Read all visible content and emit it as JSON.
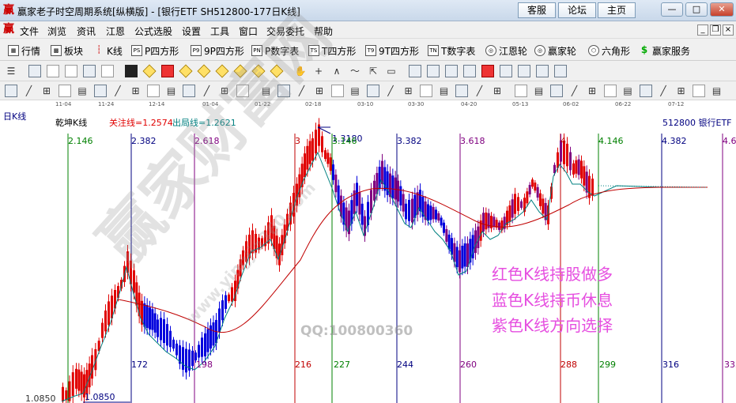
{
  "window": {
    "title": "赢家老子时空周期系统[纵横版] - [银行ETF  SH512800-177日K线]",
    "buttons": [
      "客服",
      "论坛",
      "主页"
    ],
    "controls": [
      "—",
      "□",
      "✕"
    ]
  },
  "menu": {
    "items": [
      "文件",
      "浏览",
      "资讯",
      "江恩",
      "公式选股",
      "设置",
      "工具",
      "窗口",
      "交易委托",
      "帮助"
    ],
    "mdi_controls": [
      "_",
      "❐",
      "×"
    ]
  },
  "function_bar": [
    {
      "label": "行情",
      "icon": "quote-grid-icon"
    },
    {
      "label": "板块",
      "icon": "sector-blocks-icon"
    },
    {
      "label": "K线",
      "icon": "kline-icon"
    },
    {
      "label": "P四方形",
      "icon": "PS"
    },
    {
      "label": "9P四方形",
      "icon": "P9"
    },
    {
      "label": "P数字表",
      "icon": "PN"
    },
    {
      "label": "T四方形",
      "icon": "TS"
    },
    {
      "label": "9T四方形",
      "icon": "T9"
    },
    {
      "label": "T数字表",
      "icon": "TN"
    },
    {
      "label": "江恩轮",
      "icon": "wheel-icon"
    },
    {
      "label": "赢家轮",
      "icon": "wheel-icon"
    },
    {
      "label": "六角形",
      "icon": "hexagon-icon"
    },
    {
      "label": "赢家服务",
      "icon": "dollar-icon"
    }
  ],
  "date_axis": [
    "11-04",
    "11-24",
    "12-14",
    "01-04",
    "01-22",
    "02-18",
    "03-10",
    "03-30",
    "04-20",
    "05-13",
    "06-02",
    "06-22",
    "07-12"
  ],
  "chart": {
    "left_title": "日K线",
    "subtitle": "乾坤K线",
    "indicator_focus": "关注线=1.2574",
    "indicator_exit": "出局线=1.2621",
    "symbol": "512800  银行ETF",
    "high_label": "1.3180",
    "low_label": "1.0850",
    "y_axis_low": "1.0850",
    "cycle_labels_top": [
      {
        "text": "2.146",
        "color": "#008000"
      },
      {
        "text": "2.382",
        "color": "#000080"
      },
      {
        "text": "2.618",
        "color": "#800080"
      },
      {
        "text": "3",
        "color": "#c00000"
      },
      {
        "text": "3.146",
        "color": "#008000"
      },
      {
        "text": "3.382",
        "color": "#000080"
      },
      {
        "text": "3.618",
        "color": "#800080"
      },
      {
        "text": "4",
        "color": "#c00000"
      },
      {
        "text": "4.146",
        "color": "#008000"
      },
      {
        "text": "4.382",
        "color": "#000080"
      },
      {
        "text": "4.6",
        "color": "#800080"
      }
    ],
    "cycle_labels_bottom": [
      {
        "text": "172",
        "color": "#000080"
      },
      {
        "text": "198",
        "color": "#800080"
      },
      {
        "text": "216",
        "color": "#c00000"
      },
      {
        "text": "227",
        "color": "#008000"
      },
      {
        "text": "244",
        "color": "#000080"
      },
      {
        "text": "260",
        "color": "#800080"
      },
      {
        "text": "288",
        "color": "#c00000"
      },
      {
        "text": "299",
        "color": "#008000"
      },
      {
        "text": "316",
        "color": "#000080"
      },
      {
        "text": "333",
        "color": "#800080"
      }
    ],
    "notes": [
      "红色K线持股做多",
      "蓝色K线持币休息",
      "紫色K线方向选择"
    ],
    "watermark_main": "赢家财富网",
    "watermark_url": "www.yingjia360.com",
    "watermark_qq": "QQ:100800360",
    "colors": {
      "up": "#e00000",
      "down": "#0000dd",
      "neutral": "#800080",
      "ma_fast": "#008080",
      "ma_slow": "#c00000",
      "note": "#e64fe0"
    }
  },
  "chart_data": {
    "type": "candlestick",
    "symbol": "512800",
    "name": "银行ETF",
    "period": "177日K线",
    "price_range": [
      1.085,
      1.318
    ],
    "marked_high": 1.318,
    "marked_low": 1.085,
    "focus_line": 1.2574,
    "exit_line": 1.2621,
    "fib_time_labels": [
      "2.146",
      "2.382",
      "2.618",
      "3",
      "3.146",
      "3.382",
      "3.618",
      "4",
      "4.146",
      "4.382"
    ],
    "bar_counts": [
      172,
      198,
      216,
      227,
      244,
      260,
      288,
      299,
      316
    ]
  }
}
